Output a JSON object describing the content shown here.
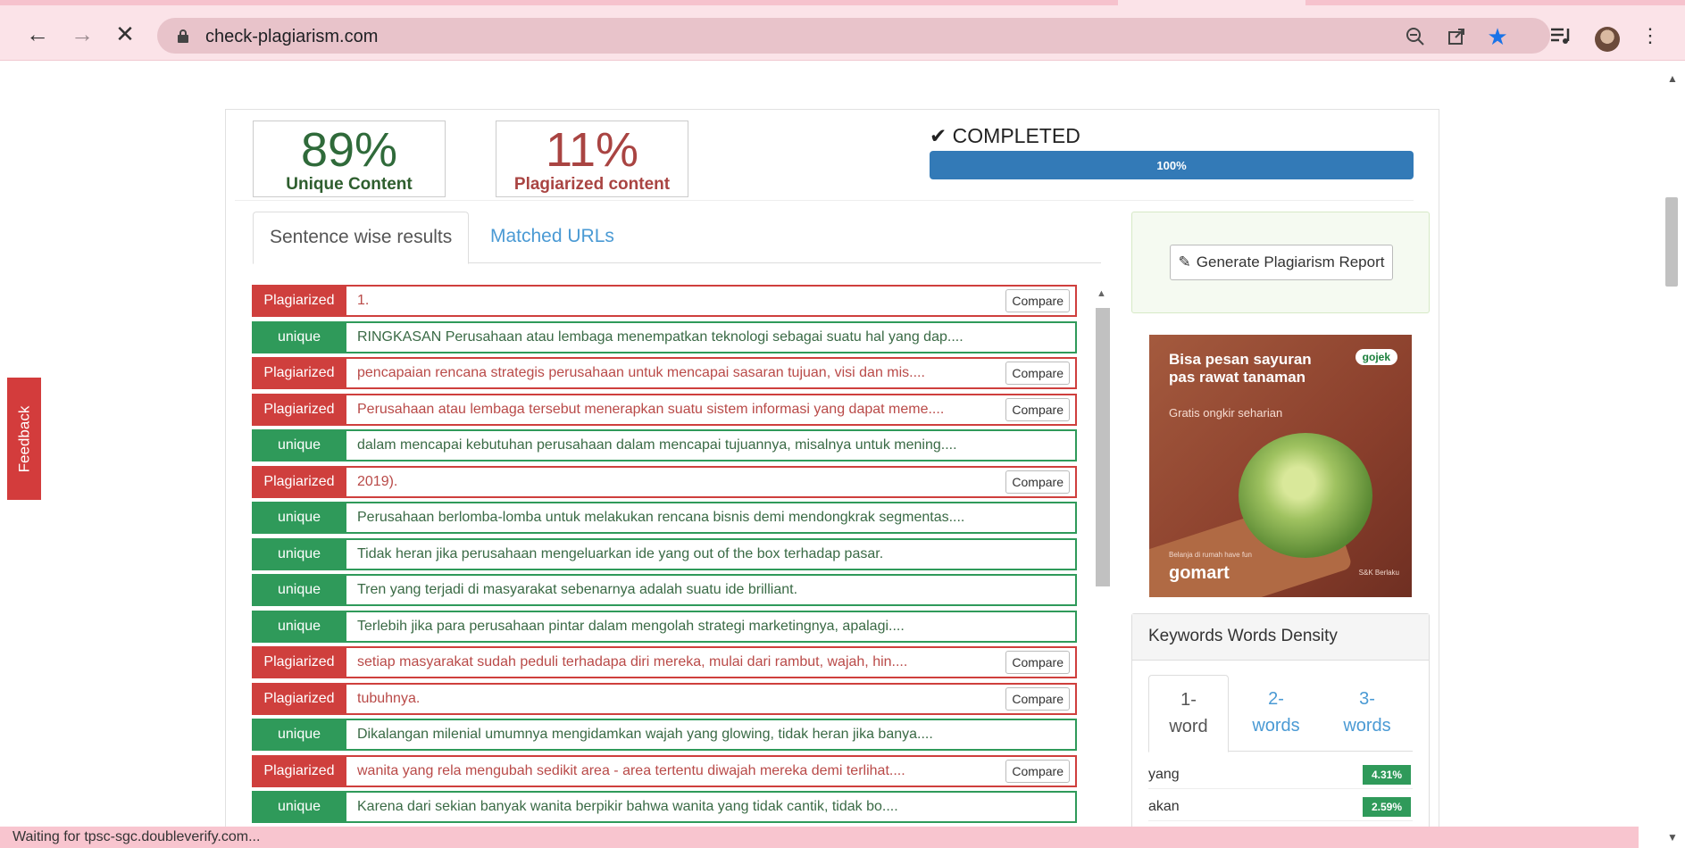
{
  "browser": {
    "url": "check-plagiarism.com",
    "status_text": "Waiting for tpsc-sgc.doubleverify.com..."
  },
  "feedback_label": "Feedback",
  "stats": {
    "unique_pct": "89%",
    "unique_label": "Unique Content",
    "plag_pct": "11%",
    "plag_label": "Plagiarized content"
  },
  "progress": {
    "status": "COMPLETED",
    "value": 100,
    "label": "100%"
  },
  "tabs": {
    "sentence": "Sentence wise results",
    "urls": "Matched URLs"
  },
  "compare_label": "Compare",
  "results": [
    {
      "type": "Plagiarized",
      "text": "1."
    },
    {
      "type": "unique",
      "text": "RINGKASAN Perusahaan atau lembaga menempatkan teknologi sebagai suatu hal yang dap...."
    },
    {
      "type": "Plagiarized",
      "text": "pencapaian rencana strategis perusahaan untuk mencapai sasaran tujuan, visi dan mis...."
    },
    {
      "type": "Plagiarized",
      "text": "Perusahaan atau lembaga tersebut menerapkan suatu sistem informasi yang dapat meme...."
    },
    {
      "type": "unique",
      "text": "dalam mencapai kebutuhan perusahaan dalam mencapai tujuannya, misalnya untuk mening...."
    },
    {
      "type": "Plagiarized",
      "text": "2019)."
    },
    {
      "type": "unique",
      "text": "Perusahaan berlomba-lomba untuk melakukan rencana bisnis demi mendongkrak segmentas...."
    },
    {
      "type": "unique",
      "text": "Tidak heran jika perusahaan mengeluarkan ide yang out of the box terhadap pasar."
    },
    {
      "type": "unique",
      "text": "Tren yang terjadi di masyarakat sebenarnya adalah suatu ide brilliant."
    },
    {
      "type": "unique",
      "text": "Terlebih jika para perusahaan pintar dalam mengolah strategi marketingnya, apalagi...."
    },
    {
      "type": "Plagiarized",
      "text": "setiap masyarakat sudah peduli terhadapa diri mereka, mulai dari rambut, wajah, hin...."
    },
    {
      "type": "Plagiarized",
      "text": "tubuhnya."
    },
    {
      "type": "unique",
      "text": "Dikalangan milenial umumnya mengidamkan wajah yang glowing, tidak heran jika banya...."
    },
    {
      "type": "Plagiarized",
      "text": "wanita yang rela mengubah sedikit area - area tertentu diwajah mereka demi terlihat...."
    },
    {
      "type": "unique",
      "text": "Karena dari sekian banyak wanita berpikir bahwa wanita yang tidak cantik, tidak bo...."
    }
  ],
  "report_button": "Generate Plagiarism Report",
  "ad": {
    "headline": "Bisa pesan sayuran pas rawat tanaman",
    "sub": "Gratis ongkir seharian",
    "brand_badge": "gojek",
    "small1": "Belanja di rumah have fun",
    "brand": "gomart",
    "small2": "S&K Berlaku"
  },
  "keywords": {
    "title": "Keywords Words Density",
    "tab1": "1-\nword",
    "tab2": "2-\nwords",
    "tab3": "3-\nwords",
    "rows": [
      {
        "word": "yang",
        "value": "4.31%"
      },
      {
        "word": "akan",
        "value": "2.59%"
      }
    ]
  },
  "colors": {
    "plagiarized": "#cf3f3d",
    "unique": "#2f9a5a",
    "progress": "#337ab7",
    "chrome": "#fbe3e8"
  }
}
